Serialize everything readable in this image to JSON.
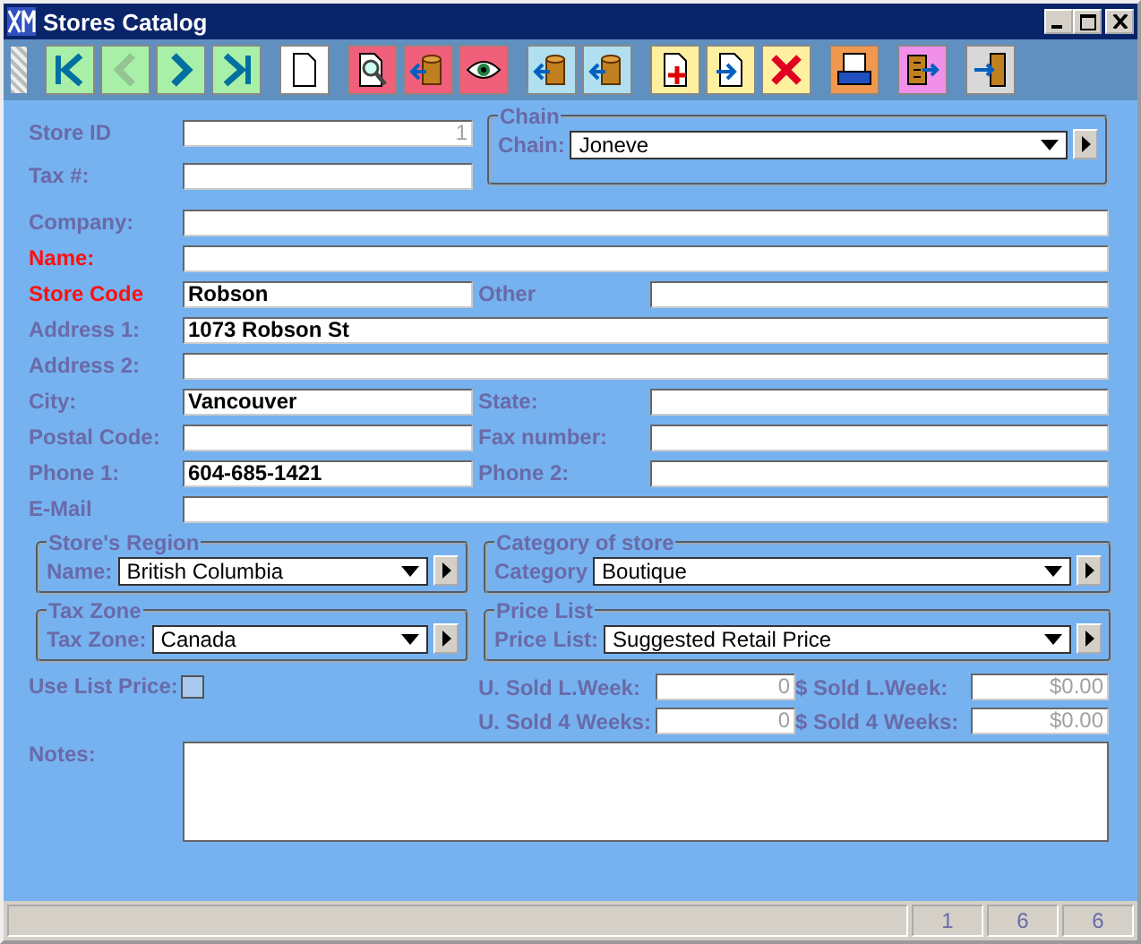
{
  "window": {
    "title": "Stores Catalog"
  },
  "toolbar": {
    "buttons": [
      {
        "color": "#a8f0a8",
        "disabled": false
      },
      {
        "color": "#a8f0a8",
        "disabled": true
      },
      {
        "color": "#a8f0a8",
        "disabled": false
      },
      {
        "color": "#a8f0a8",
        "disabled": false
      },
      {
        "color": "#ffffff",
        "disabled": false
      },
      {
        "color": "#f0607a",
        "disabled": false
      },
      {
        "color": "#f0607a",
        "disabled": false
      },
      {
        "color": "#f0607a",
        "disabled": false
      },
      {
        "color": "#b0e0f0",
        "disabled": false
      },
      {
        "color": "#b0e0f0",
        "disabled": false
      },
      {
        "color": "#fff0a0",
        "disabled": false
      },
      {
        "color": "#fff0a0",
        "disabled": false
      },
      {
        "color": "#fff0a0",
        "disabled": false
      },
      {
        "color": "#f09850",
        "disabled": false
      },
      {
        "color": "#f090e8",
        "disabled": false
      },
      {
        "color": "#d8d8d8",
        "disabled": false
      }
    ]
  },
  "store_id": {
    "label": "Store ID",
    "value": "1"
  },
  "tax": {
    "label": "Tax #:"
  },
  "chain": {
    "title": "Chain",
    "label": "Chain:",
    "value": "Joneve"
  },
  "rows": [
    {
      "kind": "full",
      "label": "Company:",
      "required": false
    },
    {
      "kind": "full",
      "label": "Name:",
      "required": true
    },
    {
      "kind": "pair",
      "label": "Store Code",
      "value": "Robson",
      "required": true,
      "label2": "Other"
    },
    {
      "kind": "full",
      "label": "Address 1:",
      "value": "1073 Robson St",
      "required": false
    },
    {
      "kind": "full",
      "label": "Address 2:",
      "required": false
    },
    {
      "kind": "pair",
      "label": "City:",
      "value": "Vancouver",
      "required": false,
      "label2": "State:"
    },
    {
      "kind": "pair",
      "label": "Postal Code:",
      "required": false,
      "label2": "Fax number:"
    },
    {
      "kind": "pair",
      "label": "Phone 1:",
      "value": "604-685-1421",
      "required": false,
      "label2": "Phone 2:"
    },
    {
      "kind": "full",
      "label": "E-Mail",
      "required": false
    }
  ],
  "groups": [
    {
      "title": "Store's Region",
      "label": "Name:",
      "value": "British Columbia"
    },
    {
      "title": "Category of store",
      "label": "Category",
      "value": "Boutique"
    },
    {
      "title": "Tax Zone",
      "label": "Tax Zone:",
      "value": "Canada"
    },
    {
      "title": "Price List",
      "label": "Price List:",
      "value": "Suggested Retail Price"
    }
  ],
  "use_list_price": {
    "label": "Use List Price:",
    "checked": false
  },
  "stats": [
    {
      "label": "U. Sold L.Week:",
      "value": "0"
    },
    {
      "label": "$ Sold L.Week:",
      "value": "$0.00"
    },
    {
      "label": "U. Sold 4 Weeks:",
      "value": "0"
    },
    {
      "label": "$ Sold 4 Weeks:",
      "value": "$0.00"
    }
  ],
  "notes": {
    "label": "Notes:"
  },
  "status_bar": {
    "panels": [
      "1",
      "6",
      "6"
    ]
  }
}
